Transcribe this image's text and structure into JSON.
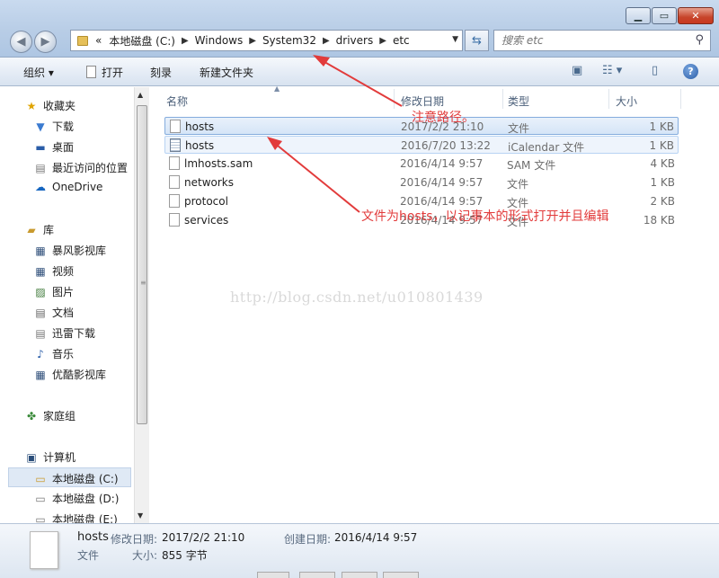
{
  "window": {
    "minimize_icon": "minimize-icon",
    "maximize_icon": "maximize-icon",
    "close_icon": "close-icon"
  },
  "nav": {
    "back_icon": "back-arrow-icon",
    "forward_icon": "forward-arrow-icon"
  },
  "address": {
    "overflow": "«",
    "crumbs": [
      "本地磁盘 (C:)",
      "Windows",
      "System32",
      "drivers",
      "etc"
    ]
  },
  "search": {
    "placeholder": "搜索 etc"
  },
  "toolbar": {
    "organize": "组织 ▾",
    "open": "打开",
    "burn": "刻录",
    "new_folder": "新建文件夹"
  },
  "sidebar": {
    "favorites": "收藏夹",
    "downloads": "下载",
    "desktop": "桌面",
    "recent": "最近访问的位置",
    "onedrive": "OneDrive",
    "libraries": "库",
    "baofeng": "暴风影视库",
    "videos": "视频",
    "pictures": "图片",
    "documents": "文档",
    "xunlei": "迅雷下载",
    "music": "音乐",
    "youku": "优酷影视库",
    "homegroup": "家庭组",
    "computer": "计算机",
    "drive_c": "本地磁盘 (C:)",
    "drive_d": "本地磁盘 (D:)",
    "drive_e": "本地磁盘 (E:)"
  },
  "columns": {
    "name": "名称",
    "date": "修改日期",
    "type": "类型",
    "size": "大小"
  },
  "files": [
    {
      "name": "hosts",
      "date": "2017/2/2 21:10",
      "type": "文件",
      "size": "1 KB"
    },
    {
      "name": "hosts",
      "date": "2016/7/20 13:22",
      "type": "iCalendar 文件",
      "size": "1 KB"
    },
    {
      "name": "lmhosts.sam",
      "date": "2016/4/14 9:57",
      "type": "SAM 文件",
      "size": "4 KB"
    },
    {
      "name": "networks",
      "date": "2016/4/14 9:57",
      "type": "文件",
      "size": "1 KB"
    },
    {
      "name": "protocol",
      "date": "2016/4/14 9:57",
      "type": "文件",
      "size": "2 KB"
    },
    {
      "name": "services",
      "date": "2016/4/14 9:57",
      "type": "文件",
      "size": "18 KB"
    }
  ],
  "annotations": {
    "path_note": "注意路径。",
    "file_note": "文件为hosts，以记事本的形式打开并且编辑",
    "color": "#e23b3b"
  },
  "watermark": "http://blog.csdn.net/u010801439",
  "details": {
    "name": "hosts",
    "modified_label": "修改日期:",
    "modified_value": "2017/2/2 21:10",
    "created_label": "创建日期:",
    "created_value": "2016/4/14 9:57",
    "type_value": "文件",
    "size_label": "大小:",
    "size_value": "855 字节"
  }
}
